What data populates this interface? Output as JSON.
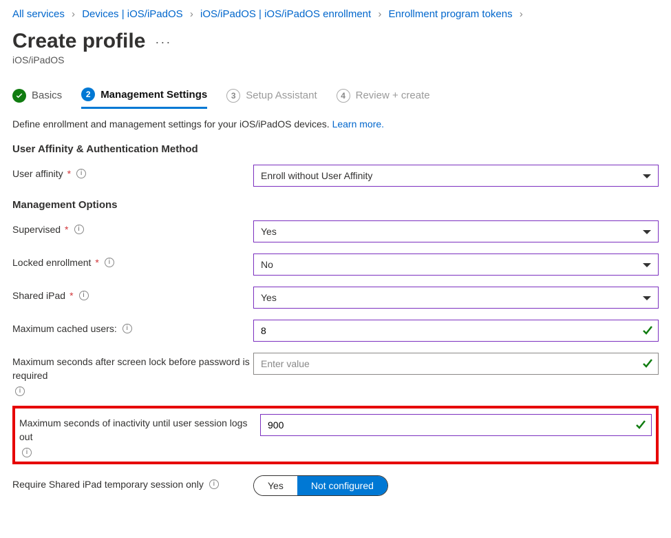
{
  "breadcrumb": {
    "items": [
      {
        "label": "All services"
      },
      {
        "label": "Devices | iOS/iPadOS"
      },
      {
        "label": "iOS/iPadOS | iOS/iPadOS enrollment"
      },
      {
        "label": "Enrollment program tokens"
      }
    ],
    "separator": "›"
  },
  "header": {
    "title": "Create profile",
    "more": "···",
    "subtitle": "iOS/iPadOS"
  },
  "tabs": [
    {
      "num": "✓",
      "label": "Basics",
      "state": "done"
    },
    {
      "num": "2",
      "label": "Management Settings",
      "state": "active"
    },
    {
      "num": "3",
      "label": "Setup Assistant",
      "state": "pending"
    },
    {
      "num": "4",
      "label": "Review + create",
      "state": "pending"
    }
  ],
  "intro": {
    "text": "Define enrollment and management settings for your iOS/iPadOS devices. ",
    "link": "Learn more."
  },
  "sections": {
    "auth_h": "User Affinity & Authentication Method",
    "mgmt_h": "Management Options"
  },
  "fields": {
    "user_affinity": {
      "label": "User affinity",
      "required": true,
      "value": "Enroll without User Affinity"
    },
    "supervised": {
      "label": "Supervised",
      "required": true,
      "value": "Yes"
    },
    "locked": {
      "label": "Locked enrollment",
      "required": true,
      "value": "No"
    },
    "shared_ipad": {
      "label": "Shared iPad",
      "required": true,
      "value": "Yes"
    },
    "max_cached": {
      "label": "Maximum cached users:",
      "value": "8"
    },
    "max_lock": {
      "label": "Maximum seconds after screen lock before password is required",
      "placeholder": "Enter value",
      "value": ""
    },
    "max_inactivity": {
      "label": "Maximum seconds of inactivity until user session logs out",
      "value": "900"
    },
    "temp_session": {
      "label": "Require Shared iPad temporary session only",
      "options": {
        "yes": "Yes",
        "no": "Not configured"
      },
      "selected": "no"
    }
  }
}
